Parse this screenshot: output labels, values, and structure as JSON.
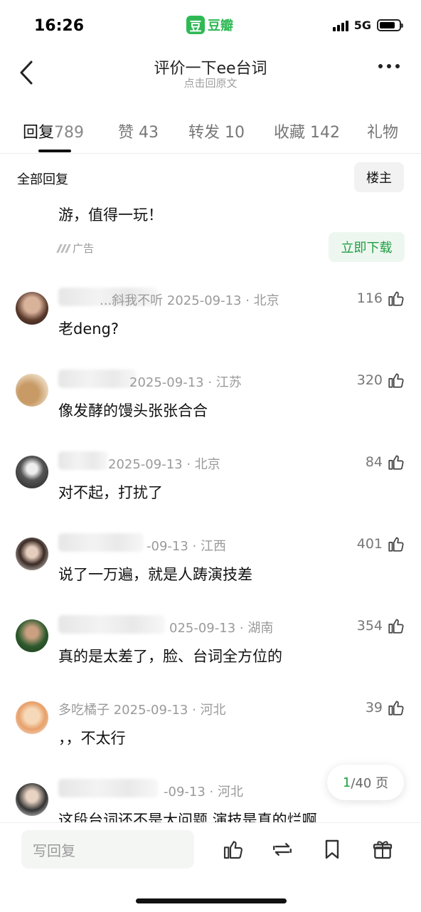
{
  "status_bar": {
    "time": "16:26",
    "app_logo_char": "豆",
    "app_name": "豆瓣",
    "network": "5G",
    "battery_level": 0.8
  },
  "header": {
    "title": "评价一下ee台词",
    "subtitle": "点击回原文"
  },
  "tabs": [
    {
      "label": "回复",
      "count": "789"
    },
    {
      "label": "赞",
      "count": "43"
    },
    {
      "label": "转发",
      "count": "10"
    },
    {
      "label": "收藏",
      "count": "142"
    },
    {
      "label": "礼物",
      "count": ""
    }
  ],
  "section": {
    "all_replies": "全部回复",
    "op_filter": "楼主"
  },
  "ad": {
    "text": "游，值得一玩！",
    "tag": "广告",
    "button": "立即下载"
  },
  "comments": [
    {
      "name_visible": "...斜我不听",
      "meta": "2025-09-13 · 北京",
      "likes": "116",
      "text": "老deng?"
    },
    {
      "name_visible": "",
      "meta": "2025-09-13 · 江苏",
      "likes": "320",
      "text": "像发酵的馒头张张合合"
    },
    {
      "name_visible": "",
      "meta": "2025-09-13 · 北京",
      "likes": "84",
      "text": "对不起，打扰了"
    },
    {
      "name_visible": "",
      "meta": "-09-13 · 江西",
      "likes": "401",
      "text": "说了一万遍，就是人踌演技差"
    },
    {
      "name_visible": "",
      "meta": "025-09-13 · 湖南",
      "likes": "354",
      "text": "真的是太差了，脸、台词全方位的"
    },
    {
      "name_visible": "多吃橘子",
      "meta": "2025-09-13 · 河北",
      "likes": "39",
      "text": "，，不太行"
    },
    {
      "name_visible": "",
      "meta": "-09-13 · 河北",
      "likes": "",
      "text": "这段台词还不是大问题 演技是真的烂啊"
    }
  ],
  "pager": {
    "current": "1",
    "total": "/40 页"
  },
  "bottom_bar": {
    "reply_placeholder": "写回复",
    "icons": [
      "like-icon",
      "repost-icon",
      "bookmark-icon",
      "gift-icon"
    ]
  },
  "colors": {
    "accent_green": "#1f9e44",
    "brand_green": "#2fb955"
  }
}
